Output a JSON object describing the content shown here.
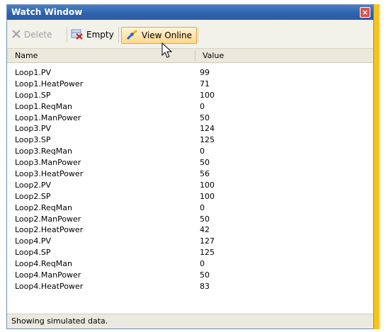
{
  "window": {
    "title": "Watch Window",
    "close_icon": "×"
  },
  "toolbar": {
    "delete_label": "Delete",
    "empty_label": "Empty",
    "view_online_label": "View Online"
  },
  "table": {
    "columns": [
      "Name",
      "Value"
    ],
    "rows": [
      {
        "name": "Loop1.PV",
        "value": "99"
      },
      {
        "name": "Loop1.HeatPower",
        "value": "71"
      },
      {
        "name": "Loop1.SP",
        "value": "100"
      },
      {
        "name": "Loop1.ReqMan",
        "value": "0"
      },
      {
        "name": "Loop1.ManPower",
        "value": "50"
      },
      {
        "name": "Loop3.PV",
        "value": "124"
      },
      {
        "name": "Loop3.SP",
        "value": "125"
      },
      {
        "name": "Loop3.ReqMan",
        "value": "0"
      },
      {
        "name": "Loop3.ManPower",
        "value": "50"
      },
      {
        "name": "Loop3.HeatPower",
        "value": "56"
      },
      {
        "name": "Loop2.PV",
        "value": "100"
      },
      {
        "name": "Loop2.SP",
        "value": "100"
      },
      {
        "name": "Loop2.ReqMan",
        "value": "0"
      },
      {
        "name": "Loop2.ManPower",
        "value": "50"
      },
      {
        "name": "Loop2.HeatPower",
        "value": "42"
      },
      {
        "name": "Loop4.PV",
        "value": "127"
      },
      {
        "name": "Loop4.SP",
        "value": "125"
      },
      {
        "name": "Loop4.ReqMan",
        "value": "0"
      },
      {
        "name": "Loop4.ManPower",
        "value": "50"
      },
      {
        "name": "Loop4.HeatPower",
        "value": "83"
      }
    ]
  },
  "status": {
    "text": "Showing simulated data."
  },
  "colors": {
    "titlebar": "#2f63ad",
    "accent": "#f6c31a"
  }
}
